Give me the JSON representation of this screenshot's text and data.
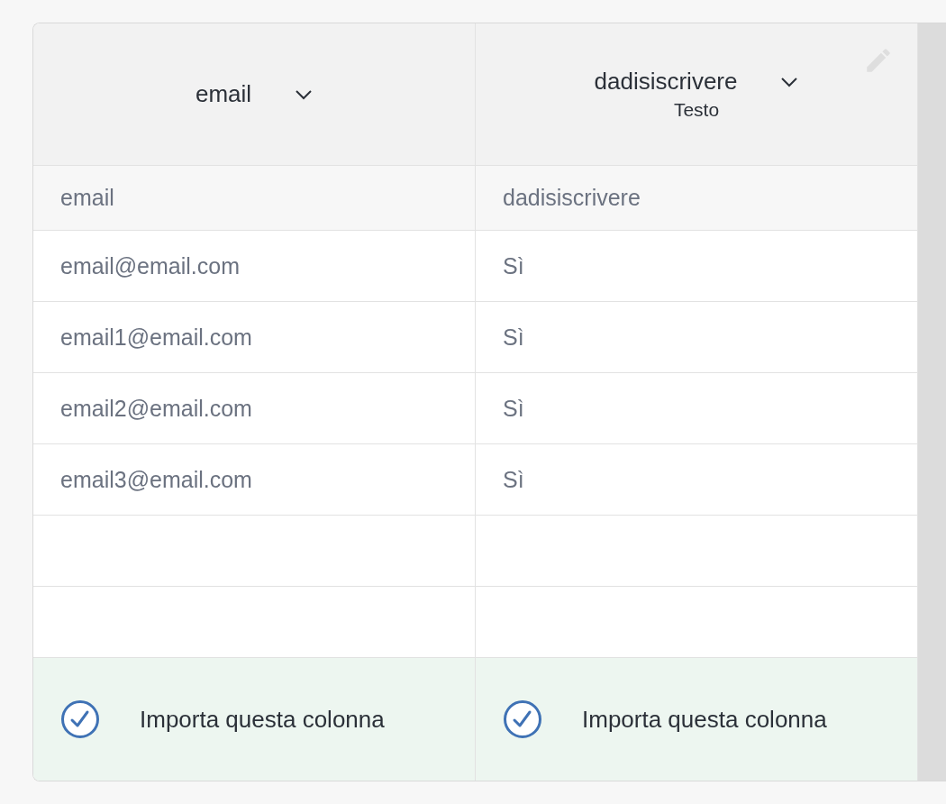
{
  "columns": [
    {
      "name": "email",
      "edit_icon": false,
      "source_header": "email",
      "import": {
        "label": "Importa questa colonna",
        "checked": true
      }
    },
    {
      "name": "dadisiscrivere",
      "type": "Testo",
      "edit_icon": true,
      "source_header": "dadisiscrivere",
      "import": {
        "label": "Importa questa colonna",
        "checked": true
      }
    }
  ],
  "rows": [
    [
      "email@email.com",
      "Sì"
    ],
    [
      "email1@email.com",
      "Sì"
    ],
    [
      "email2@email.com",
      "Sì"
    ],
    [
      "email3@email.com",
      "Sì"
    ],
    [
      "",
      ""
    ],
    [
      "",
      ""
    ]
  ]
}
